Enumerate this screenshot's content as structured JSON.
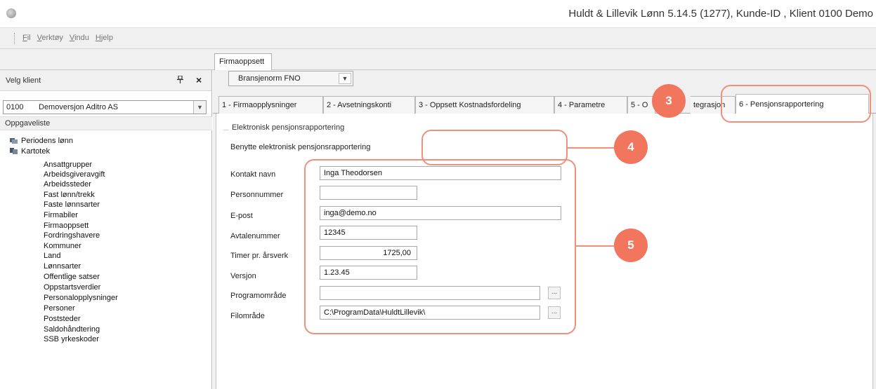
{
  "window": {
    "title": "Huldt & Lillevik Lønn 5.14.5 (1277), Kunde-ID , Klient 0100 Demo"
  },
  "menu": {
    "items": [
      "Fil",
      "Verktøy",
      "Vindu",
      "Hjelp"
    ]
  },
  "doc_tab": {
    "label": "Firmaoppsett"
  },
  "left_panel": {
    "header": "Velg klient",
    "pin_icon": "pin-icon",
    "close_glyph": "×",
    "client_code": "0100",
    "client_name": "Demoversjon Aditro AS",
    "tasklist_label": "Oppgaveliste",
    "tree_top": [
      {
        "label": "Periodens lønn",
        "icon": "folder-periodens-icon"
      },
      {
        "label": "Kartotek",
        "icon": "folder-kartotek-icon"
      }
    ],
    "tree_items": [
      "Ansattgrupper",
      "Arbeidsgiveravgift",
      "Arbeidssteder",
      "Fast lønn/trekk",
      "Faste lønnsarter",
      "Firmabiler",
      "Firmaoppsett",
      "Fordringshavere",
      "Kommuner",
      "Land",
      "Lønnsarter",
      "Offentlige satser",
      "Oppstartsverdier",
      "Personalopplysninger",
      "Personer",
      "Poststeder",
      "Saldohåndtering",
      "SSB yrkeskoder"
    ]
  },
  "toolbar": {
    "icons": [
      "save-icon",
      "undo-icon",
      "print-icon",
      "print-preview-icon",
      "document-icon"
    ]
  },
  "tabs": [
    {
      "label": "1 - Firmaopplysninger"
    },
    {
      "label": "2 - Avsetningskonti"
    },
    {
      "label": "3 - Oppsett Kostnadsfordeling"
    },
    {
      "label": "4 - Parametre"
    },
    {
      "label": "5 - O"
    },
    {
      "label": "tegrasjon"
    },
    {
      "label": "6 - Pensjonsrapportering"
    }
  ],
  "form": {
    "group_title": "Elektronisk pensjonsrapportering",
    "use_label": "Benytte elektronisk pensjonsrapportering",
    "use_value": "Bransjenorm FNO",
    "contact_label": "Kontakt navn",
    "contact_value": "Inga Theodorsen",
    "personnr_label": "Personnummer",
    "personnr_value": "",
    "email_label": "E-post",
    "email_value": "inga@demo.no",
    "agreement_label": "Avtalenummer",
    "agreement_value": "12345",
    "hours_label": "Timer pr. årsverk",
    "hours_value": "1725,00",
    "version_label": "Versjon",
    "version_value": "1.23.45",
    "program_label": "Programområde",
    "program_value": "",
    "file_label": "Filområde",
    "file_value": "C:\\ProgramData\\HuldtLillevik\\",
    "browse_glyph": "..."
  },
  "annotations": {
    "badge3": "3",
    "badge4": "4",
    "badge5": "5",
    "color": "#f2755d"
  }
}
